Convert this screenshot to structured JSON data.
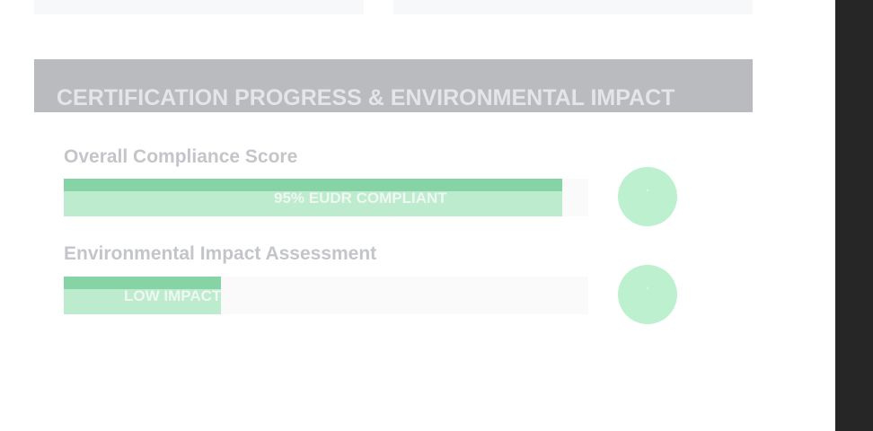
{
  "colors": {
    "header_bg": "#b9bbbf",
    "bar_fill": "#bdebce",
    "bar_cap": "#86d3a6",
    "circle": "#bdf0cf",
    "side_panel": "#262626"
  },
  "section": {
    "title": "CERTIFICATION PROGRESS & ENVIRONMENTAL IMPACT"
  },
  "metrics": [
    {
      "label": "Overall Compliance Score",
      "bar_text": "95% EUDR COMPLIANT",
      "progress_percent": 95,
      "indicator": "'"
    },
    {
      "label": "Environmental Impact Assessment",
      "bar_text": "LOW IMPACT",
      "progress_percent": 30,
      "indicator": "'"
    }
  ]
}
